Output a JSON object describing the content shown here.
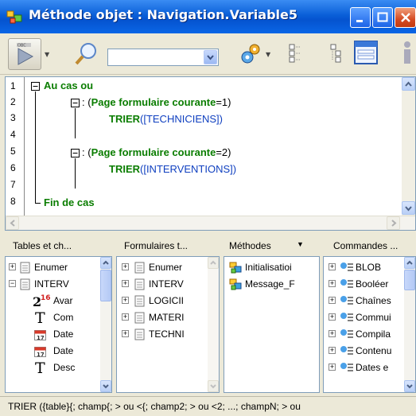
{
  "window": {
    "title": "Méthode objet : Navigation.Variable5"
  },
  "toolbar": {
    "run_icon_label": "OBC",
    "search_value": ""
  },
  "editor": {
    "line_numbers": [
      "1",
      "2",
      "3",
      "4",
      "5",
      "6",
      "7",
      "8"
    ],
    "lines": {
      "l1": "Au cas ou",
      "l2_prefix": ": (",
      "l2_fn": "Page formulaire courante",
      "l2_suffix": "=1)",
      "l3_cmd": "TRIER",
      "l3_arg": "([TECHNICIENS])",
      "l5_prefix": ": (",
      "l5_fn": "Page formulaire courante",
      "l5_suffix": "=2)",
      "l6_cmd": "TRIER",
      "l6_arg": "([INTERVENTIONS])",
      "l8": "Fin de cas"
    }
  },
  "explorer": {
    "tabs": [
      "Tables et ch...",
      "Formulaires t...",
      "Méthodes",
      "Commandes ..."
    ],
    "tables": [
      {
        "label": "Enumer",
        "expanded": false
      },
      {
        "label": "INTERV",
        "expanded": true
      },
      {
        "label": "Avar",
        "type": "long-int"
      },
      {
        "label": "Com",
        "type": "text"
      },
      {
        "label": "Date",
        "type": "date"
      },
      {
        "label": "Date",
        "type": "date"
      },
      {
        "label": "Desc",
        "type": "text"
      }
    ],
    "forms": [
      "Enumer",
      "INTERV",
      "LOGICII",
      "MATERI",
      "TECHNI"
    ],
    "methods": [
      "Initialisatioi",
      "Message_F"
    ],
    "commands": [
      "BLOB",
      "Booléer",
      "Chaînes",
      "Commui",
      "Compila",
      "Contenu",
      "Dates e"
    ]
  },
  "status": {
    "text": "TRIER ({table}{; champ{; > ou <{; champ2; > ou <2; ...; champN; > ou"
  }
}
